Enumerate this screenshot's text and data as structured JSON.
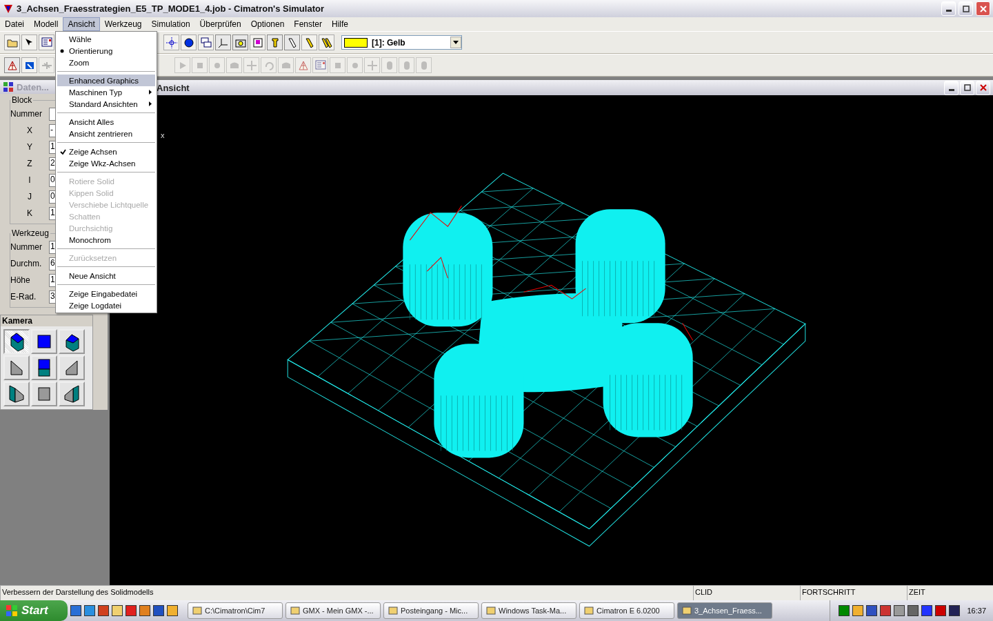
{
  "window": {
    "title": "3_Achsen_Fraesstrategien_E5_TP_MODE1_4.job - Cimatron's Simulator"
  },
  "menubar": [
    {
      "label": "Datei",
      "selected": false
    },
    {
      "label": "Modell",
      "selected": false
    },
    {
      "label": "Ansicht",
      "selected": true
    },
    {
      "label": "Werkzeug",
      "selected": false
    },
    {
      "label": "Simulation",
      "selected": false
    },
    {
      "label": "Überprüfen",
      "selected": false
    },
    {
      "label": "Optionen",
      "selected": false
    },
    {
      "label": "Fenster",
      "selected": false
    },
    {
      "label": "Hilfe",
      "selected": false
    }
  ],
  "color_select": {
    "value": "[1]: Gelb"
  },
  "dropdown_menu": [
    {
      "kind": "command",
      "label": "Wähle",
      "selected": false,
      "disabled": false,
      "checked": false
    },
    {
      "kind": "radio",
      "label": "Orientierung",
      "selected": false,
      "disabled": false,
      "checked": true
    },
    {
      "kind": "command",
      "label": "Zoom",
      "selected": false,
      "disabled": false,
      "checked": false
    },
    {
      "kind": "separator"
    },
    {
      "kind": "command",
      "label": "Enhanced Graphics",
      "selected": true,
      "disabled": false,
      "checked": false
    },
    {
      "kind": "submenu",
      "label": "Maschinen Typ",
      "selected": false,
      "disabled": false,
      "checked": false
    },
    {
      "kind": "submenu",
      "label": "Standard Ansichten",
      "selected": false,
      "disabled": false,
      "checked": false
    },
    {
      "kind": "separator"
    },
    {
      "kind": "command",
      "label": "Ansicht Alles",
      "selected": false,
      "disabled": false,
      "checked": false
    },
    {
      "kind": "command",
      "label": "Ansicht zentrieren",
      "selected": false,
      "disabled": false,
      "checked": false
    },
    {
      "kind": "separator"
    },
    {
      "kind": "check",
      "label": "Zeige Achsen",
      "selected": false,
      "disabled": false,
      "checked": true
    },
    {
      "kind": "check",
      "label": "Zeige Wkz-Achsen",
      "selected": false,
      "disabled": false,
      "checked": false
    },
    {
      "kind": "separator"
    },
    {
      "kind": "command",
      "label": "Rotiere Solid",
      "selected": false,
      "disabled": true,
      "checked": false
    },
    {
      "kind": "command",
      "label": "Kippen Solid",
      "selected": false,
      "disabled": true,
      "checked": false
    },
    {
      "kind": "command",
      "label": "Verschiebe Lichtquelle",
      "selected": false,
      "disabled": true,
      "checked": false
    },
    {
      "kind": "command",
      "label": "Schatten",
      "selected": false,
      "disabled": true,
      "checked": false
    },
    {
      "kind": "command",
      "label": "Durchsichtig",
      "selected": false,
      "disabled": true,
      "checked": false
    },
    {
      "kind": "command",
      "label": "Monochrom",
      "selected": false,
      "disabled": false,
      "checked": false
    },
    {
      "kind": "separator"
    },
    {
      "kind": "command",
      "label": "Zurücksetzen",
      "selected": false,
      "disabled": true,
      "checked": false
    },
    {
      "kind": "separator"
    },
    {
      "kind": "command",
      "label": "Neue Ansicht",
      "selected": false,
      "disabled": false,
      "checked": false
    },
    {
      "kind": "separator"
    },
    {
      "kind": "command",
      "label": "Zeige Eingabedatei",
      "selected": false,
      "disabled": false,
      "checked": false
    },
    {
      "kind": "command",
      "label": "Zeige Logdatei",
      "selected": false,
      "disabled": false,
      "checked": false
    }
  ],
  "data_panel": {
    "title": "Daten...",
    "groups": [
      {
        "title": "Block",
        "fields": [
          {
            "label": "Nummer"
          },
          {
            "label": "X",
            "value": "-"
          },
          {
            "label": "Y",
            "value": "1"
          },
          {
            "label": "Z",
            "value": "2"
          },
          {
            "label": "I",
            "value": "0"
          },
          {
            "label": "J",
            "value": "0"
          },
          {
            "label": "K",
            "value": "1"
          }
        ]
      },
      {
        "title": "Werkzeug",
        "fields": [
          {
            "label": "Nummer",
            "value": "1"
          },
          {
            "label": "Durchm.",
            "value": "6"
          },
          {
            "label": "Höhe",
            "value": "1"
          },
          {
            "label": "E-Rad.",
            "value": "3"
          }
        ]
      }
    ]
  },
  "camera_panel": {
    "title": "Kamera",
    "views": [
      {
        "selected": true
      },
      {
        "selected": false
      },
      {
        "selected": false
      },
      {
        "selected": false
      },
      {
        "selected": false
      },
      {
        "selected": false
      },
      {
        "selected": false
      },
      {
        "selected": false
      },
      {
        "selected": false
      }
    ]
  },
  "view_window": {
    "title": "Ansicht",
    "axis_label": "x"
  },
  "status_bar": {
    "message": "Verbessern der Darstellung des Solidmodells",
    "panes": [
      "CLID",
      "FORTSCHRITT",
      "ZEIT"
    ]
  },
  "taskbar": {
    "start": "Start",
    "tasks": [
      {
        "label": "C:\\Cimatron\\Cim7",
        "selected": false
      },
      {
        "label": "GMX - Mein GMX -...",
        "selected": false
      },
      {
        "label": "Posteingang - Mic...",
        "selected": false
      },
      {
        "label": "Windows Task-Ma...",
        "selected": false
      },
      {
        "label": "Cimatron E 6.0200",
        "selected": false
      },
      {
        "label": "3_Achsen_Fraess...",
        "selected": true
      }
    ],
    "clock": "16:37"
  }
}
